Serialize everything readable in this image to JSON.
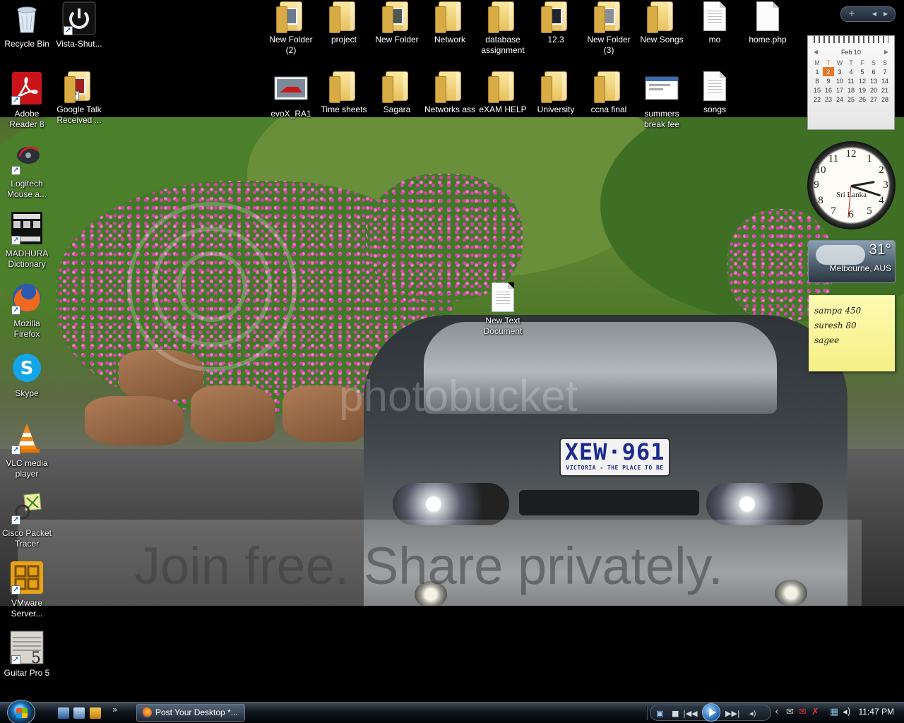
{
  "desktop": {
    "icons_left": [
      {
        "label": "Recycle Bin",
        "icon": "recycle-bin-icon"
      },
      {
        "label": "Vista-Shut...",
        "icon": "power-icon"
      },
      {
        "label": "Adobe Reader 8",
        "icon": "adobe-reader-icon"
      },
      {
        "label": "Google Talk Received ...",
        "icon": "folder-icon"
      },
      {
        "label": "Logitech Mouse a...",
        "icon": "logitech-icon"
      },
      {
        "label": "MADHURA Dictionary",
        "icon": "dictionary-icon"
      },
      {
        "label": "Mozilla Firefox",
        "icon": "firefox-icon"
      },
      {
        "label": "Skype",
        "icon": "skype-icon"
      },
      {
        "label": "VLC media player",
        "icon": "vlc-icon"
      },
      {
        "label": "Cisco Packet Tracer",
        "icon": "packet-tracer-icon"
      },
      {
        "label": "VMware Server...",
        "icon": "vmware-icon"
      },
      {
        "label": "Guitar Pro 5",
        "icon": "guitar-pro-icon"
      }
    ],
    "icons_top_row1": [
      {
        "label": "New Folder (2)",
        "icon": "folder-icon"
      },
      {
        "label": "project",
        "icon": "folder-icon"
      },
      {
        "label": "New Folder",
        "icon": "folder-icon"
      },
      {
        "label": "Network",
        "icon": "folder-icon"
      },
      {
        "label": "database assignment",
        "icon": "folder-icon"
      },
      {
        "label": "12.3",
        "icon": "folder-icon"
      },
      {
        "label": "New Folder (3)",
        "icon": "folder-icon"
      },
      {
        "label": "New Songs",
        "icon": "folder-icon"
      },
      {
        "label": "mo",
        "icon": "document-icon"
      },
      {
        "label": "home.php",
        "icon": "document-icon"
      }
    ],
    "icons_top_row2": [
      {
        "label": "evoX_RA1",
        "icon": "image-icon"
      },
      {
        "label": "Time sheets",
        "icon": "folder-icon"
      },
      {
        "label": "Sagara",
        "icon": "folder-icon"
      },
      {
        "label": "Networks ass",
        "icon": "folder-icon"
      },
      {
        "label": "eXAM HELP",
        "icon": "folder-icon"
      },
      {
        "label": "University",
        "icon": "folder-icon"
      },
      {
        "label": "ccna final",
        "icon": "folder-icon"
      },
      {
        "label": "summers break fee",
        "icon": "window-icon"
      },
      {
        "label": "songs",
        "icon": "document-icon"
      }
    ],
    "center_icon": {
      "label": "New Text Document",
      "icon": "text-document-icon"
    },
    "wallpaper": {
      "watermark_top": "photobucket",
      "watermark_bottom": "Join free. Share privately.",
      "plate_number": "XEW·961",
      "plate_caption": "VICTORIA - THE PLACE TO BE"
    }
  },
  "sidebar": {
    "controls": {
      "add": "+",
      "prev": "◂",
      "next": "▸"
    },
    "calendar": {
      "month": "Feb 10",
      "weekdays": [
        "M",
        "T",
        "W",
        "T",
        "F",
        "S",
        "S"
      ],
      "weeks": [
        [
          "",
          "",
          "",
          "",
          "",
          "",
          ""
        ],
        [
          "1",
          "2",
          "3",
          "4",
          "5",
          "6",
          "7"
        ],
        [
          "8",
          "9",
          "10",
          "11",
          "12",
          "13",
          "14"
        ],
        [
          "15",
          "16",
          "17",
          "18",
          "19",
          "20",
          "21"
        ],
        [
          "22",
          "23",
          "24",
          "25",
          "26",
          "27",
          "28"
        ]
      ],
      "today": "2"
    },
    "clock": {
      "city": "Sri Lanka",
      "numerals": [
        "12",
        "1",
        "2",
        "3",
        "4",
        "5",
        "6",
        "7",
        "8",
        "9",
        "10",
        "11"
      ]
    },
    "weather": {
      "temperature": "31°",
      "location": "Melbourne, AUS"
    },
    "note": {
      "lines": [
        "sampa 450",
        "suresh 80",
        "sagee"
      ]
    }
  },
  "taskbar": {
    "tasks": [
      {
        "label": "Post Your Desktop *...",
        "icon": "firefox-icon"
      }
    ],
    "quick_launch": [
      "show-desktop-icon",
      "switch-windows-icon",
      "media-player-icon"
    ],
    "quick_launch_more": "»",
    "media": {
      "prev": "|◀◀",
      "next": "▶▶|",
      "stop": "■"
    },
    "clock": "11:47 PM"
  },
  "colors": {
    "taskbar": "#0f161d",
    "accent_today": "#e8762a",
    "note": "#f6ef84",
    "plate_text": "#1c2a8c"
  }
}
